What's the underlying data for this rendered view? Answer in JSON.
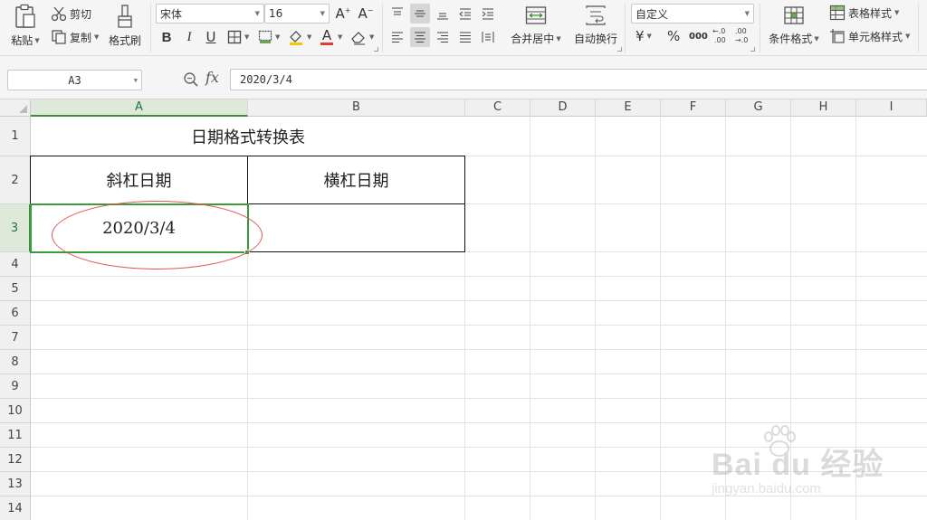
{
  "ribbon": {
    "paste": "粘贴",
    "cut": "剪切",
    "copy": "复制",
    "format_painter": "格式刷",
    "font_name": "宋体",
    "font_size": "16",
    "merge_center": "合并居中",
    "wrap_text": "自动换行",
    "number_format": "自定义",
    "currency": "¥",
    "percent": "%",
    "thousands": "000",
    "cond_format": "条件格式",
    "table_style": "表格样式",
    "cell_style": "单元格样式"
  },
  "formula_bar": {
    "name_box": "A3",
    "fx": "fx",
    "content": "2020/3/4"
  },
  "grid": {
    "columns": [
      "A",
      "B",
      "C",
      "D",
      "E",
      "F",
      "G",
      "H",
      "I"
    ],
    "rows": [
      "1",
      "2",
      "3",
      "4",
      "5",
      "6",
      "7",
      "8",
      "9",
      "10",
      "11",
      "12",
      "13",
      "14"
    ],
    "selected_column": "A",
    "selected_row": "3"
  },
  "cells": {
    "title": "日期格式转换表",
    "header_a": "斜杠日期",
    "header_b": "横杠日期",
    "a3": "2020/3/4",
    "b3": ""
  },
  "watermark": {
    "main": "Bai du 经验",
    "sub": "jingyan.baidu.com"
  }
}
